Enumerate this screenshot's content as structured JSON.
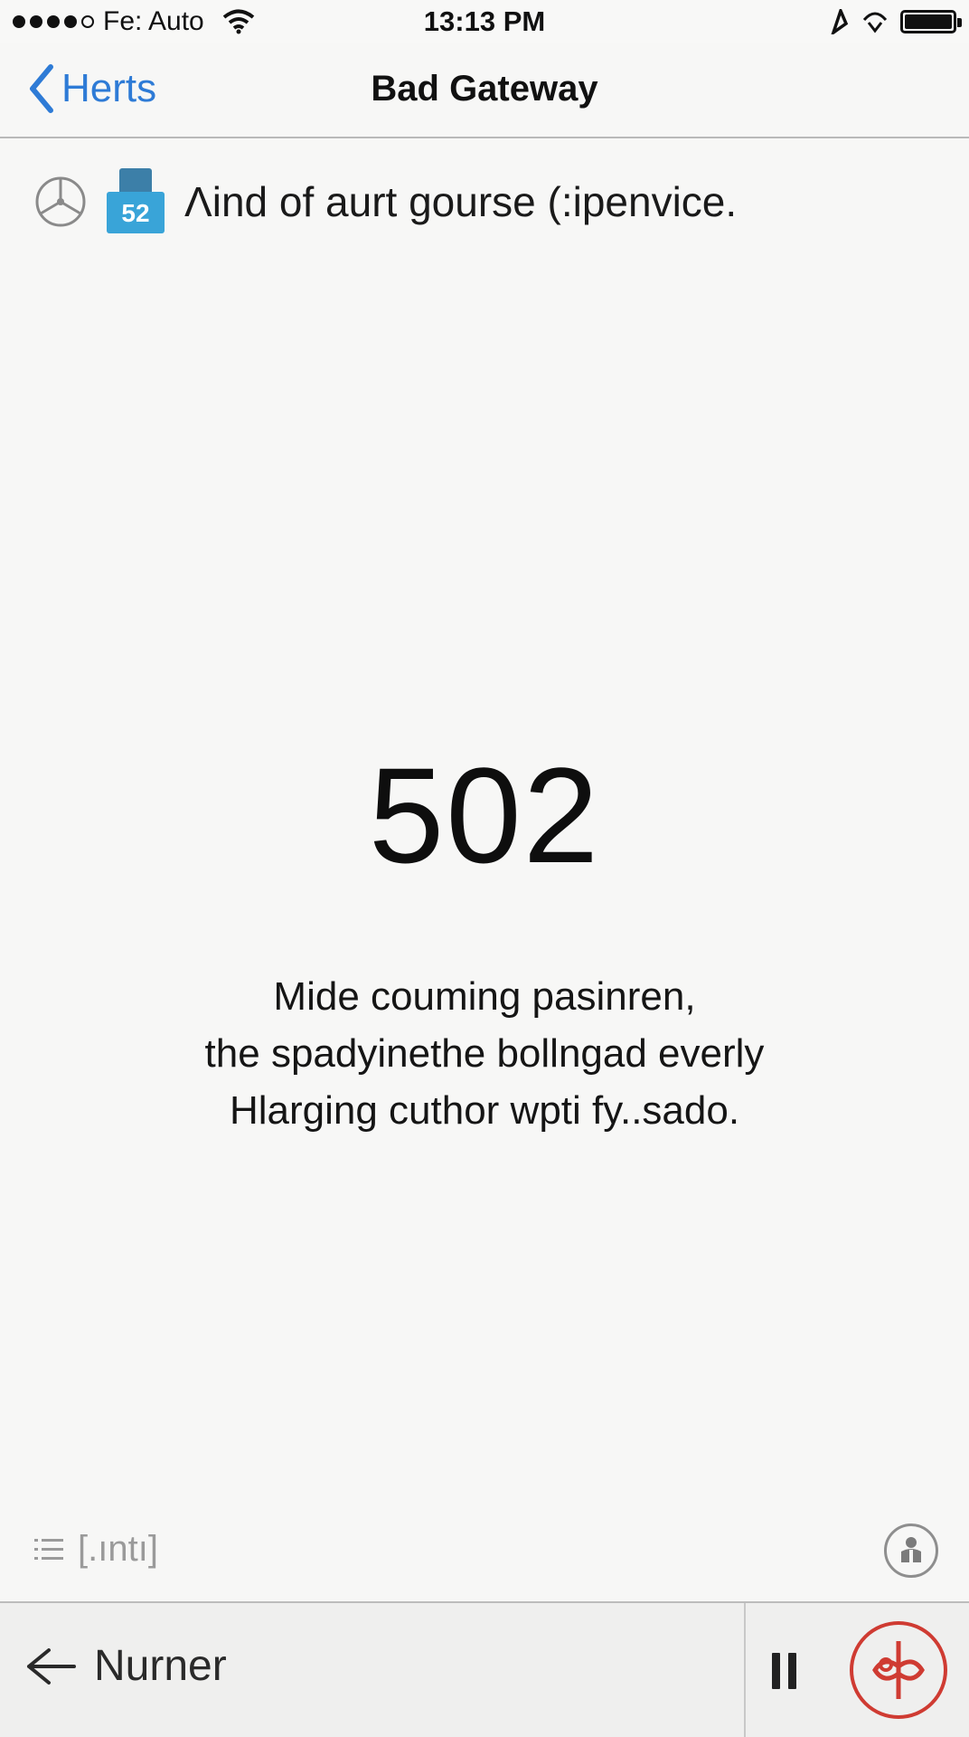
{
  "status_bar": {
    "carrier": "Fe: Auto",
    "time": "13:13 PM"
  },
  "nav": {
    "back_label": "Herts",
    "title": "Bad Gateway"
  },
  "info_row": {
    "badge_number": "52",
    "text": "Λind of aurt gourse (:ipenvice."
  },
  "main": {
    "error_code": "502",
    "message_lines": [
      "Mide couming pasinren,",
      "the spadyinethe bollngad everly",
      "Hlarging cuthor wpti fy..sado."
    ]
  },
  "bottom_controls": {
    "list_label": "[.ıntı]"
  },
  "toolbar": {
    "nav_label": "Nurner"
  },
  "colors": {
    "accent_blue": "#2e7bd6",
    "badge_blue": "#39a4d8",
    "action_red": "#cf3b32",
    "background": "#f7f7f6"
  },
  "icons": [
    "signal-dots-icon",
    "wifi-icon",
    "location-icon",
    "hotspot-icon",
    "battery-icon",
    "chevron-left-icon",
    "steering-wheel-icon",
    "badge-52-icon",
    "list-icon",
    "help-person-icon",
    "arrow-left-icon",
    "pause-icon",
    "red-action-icon"
  ]
}
